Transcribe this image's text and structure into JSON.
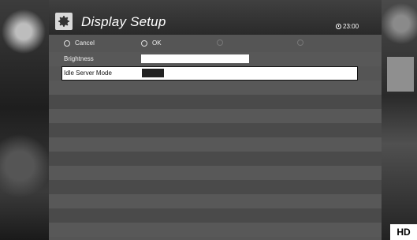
{
  "window": {
    "title": "Display Setup",
    "time": "23:00"
  },
  "softkeys": [
    {
      "label": "Cancel"
    },
    {
      "label": "OK"
    },
    {
      "label": ""
    },
    {
      "label": ""
    }
  ],
  "settings": [
    {
      "label": "Brightness",
      "value": ""
    },
    {
      "label": "Idle Server Mode",
      "value": ""
    }
  ],
  "badge": "HD",
  "icons": [
    "gear-icon",
    "clock-icon"
  ],
  "colors": {
    "header": "#2a2a2a",
    "row_selected": "#ffffff",
    "accent": "#ffffff"
  }
}
